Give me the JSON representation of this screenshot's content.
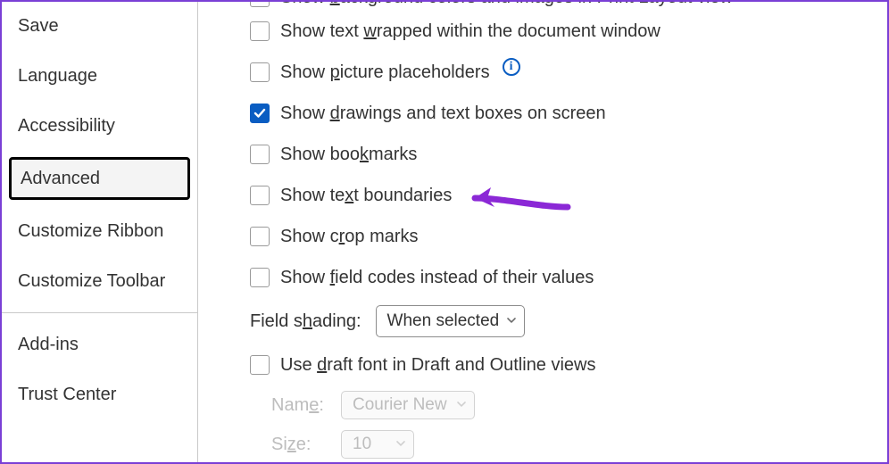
{
  "sidebar": {
    "items": [
      {
        "label": "Save"
      },
      {
        "label": "Language"
      },
      {
        "label": "Accessibility"
      },
      {
        "label": "Advanced"
      },
      {
        "label": "Customize Ribbon"
      },
      {
        "label": "Customize Toolbar"
      },
      {
        "label": "Add-ins"
      },
      {
        "label": "Trust Center"
      }
    ],
    "selected_index": 3
  },
  "options": {
    "bg_colors_pre": "Show ",
    "bg_colors_u": "b",
    "bg_colors_post": "ackground colors and images in Print Layout view",
    "wrapped_pre": "Show text ",
    "wrapped_u": "w",
    "wrapped_post": "rapped within the document window",
    "picture_pre": "Show ",
    "picture_u": "p",
    "picture_post": "icture placeholders",
    "drawings_pre": "Show ",
    "drawings_u": "d",
    "drawings_post": "rawings and text boxes on screen",
    "bookmarks_pre": "Show boo",
    "bookmarks_u": "k",
    "bookmarks_post": "marks",
    "boundaries_pre": "Show te",
    "boundaries_u": "x",
    "boundaries_post": "t boundaries",
    "crop_pre": "Show c",
    "crop_u": "r",
    "crop_post": "op marks",
    "fieldcodes_pre": "Show ",
    "fieldcodes_u": "f",
    "fieldcodes_post": "ield codes instead of their values",
    "draft_pre": "Use ",
    "draft_u": "d",
    "draft_post": "raft font in Draft and Outline views"
  },
  "field_shading": {
    "label_pre": "Field s",
    "label_u": "h",
    "label_post": "ading:",
    "value": "When selected"
  },
  "name": {
    "label_pre": "Nam",
    "label_u": "e",
    "label_post": ":",
    "value": "Courier New"
  },
  "size": {
    "label_pre": "Si",
    "label_u": "z",
    "label_post": "e:",
    "value": "10"
  },
  "colors": {
    "accent": "#0a5dc2",
    "arrow": "#8b28d6"
  }
}
